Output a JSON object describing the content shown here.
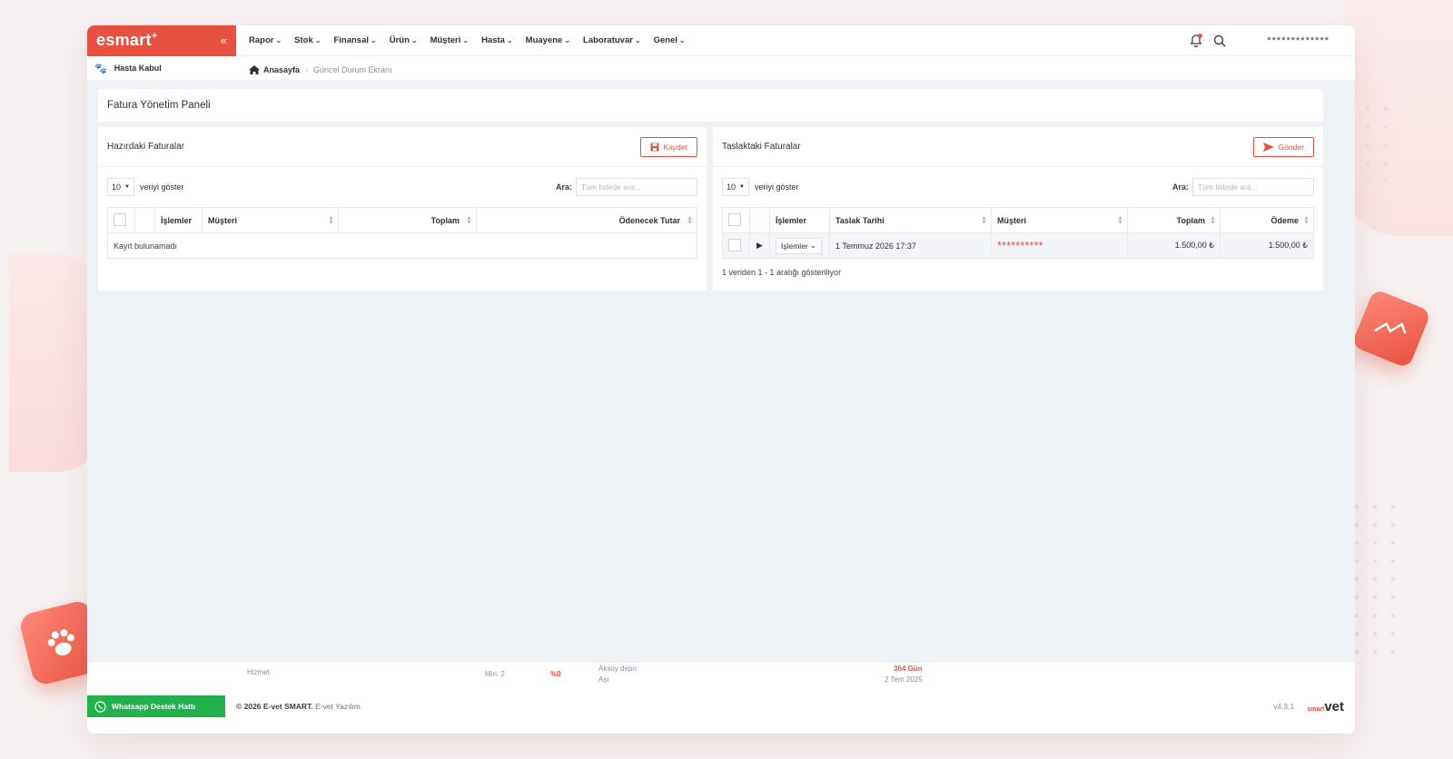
{
  "brand": {
    "logo_text": "esmart",
    "logo_plus": "+"
  },
  "nav": {
    "items": [
      "Rapor",
      "Stok",
      "Finansal",
      "Ürün",
      "Müşteri",
      "Hasta",
      "Muayene",
      "Laboratuvar",
      "Genel"
    ]
  },
  "user": {
    "name": "*************"
  },
  "sidebar": {
    "hasta_kabul": "Hasta Kabul"
  },
  "breadcrumb": {
    "home": "Anasayfa",
    "current": "Güncel Durum Ekranı"
  },
  "page": {
    "title": "Fatura Yönetim Paneli"
  },
  "left_card": {
    "title": "Hazırdaki Faturalar",
    "save_label": "Kaydet",
    "length_value": "10",
    "length_label": "veriyi göster",
    "search_label": "Ara:",
    "search_placeholder": "Tüm listede ara...",
    "columns": [
      "İşlemler",
      "Müşteri",
      "Toplam",
      "Ödenecek Tutar"
    ],
    "empty_text": "Kayıt bulunamadı"
  },
  "right_card": {
    "title": "Taslaktaki Faturalar",
    "send_label": "Gönder",
    "length_value": "10",
    "length_label": "veriyi göster",
    "search_label": "Ara:",
    "search_placeholder": "Tüm listede ara...",
    "columns": [
      "İşlemler",
      "Taslak Tarihi",
      "Müşteri",
      "Toplam",
      "Ödeme"
    ],
    "rows": [
      {
        "actions_label": "İşlemler",
        "date": "1 Temmuz 2026 17:37",
        "customer": "**********",
        "total": "1.500,00 ₺",
        "payment": "1.500,00 ₺"
      }
    ],
    "info": "1 veriden 1 - 1 aralığı gösteriliyor"
  },
  "bottom_strip": {
    "hizmet": "Hizmet",
    "min": "Min: 2",
    "percent": "%0",
    "depo": "Aksoy depo",
    "asi": "Aşı",
    "days": "364 Gün",
    "date": "2 Tem 2025"
  },
  "footer": {
    "whatsapp": "Whatsapp Destek Hattı",
    "copyright_bold": "© 2026 E-vet SMART.",
    "copyright_rest": "E-vet Yazılım",
    "version": "v4.3.1",
    "logo_small": "smart",
    "logo_big": "vet"
  },
  "colors": {
    "accent": "#e8503f",
    "whatsapp": "#22b14c",
    "content_bg": "#eef1f6"
  }
}
